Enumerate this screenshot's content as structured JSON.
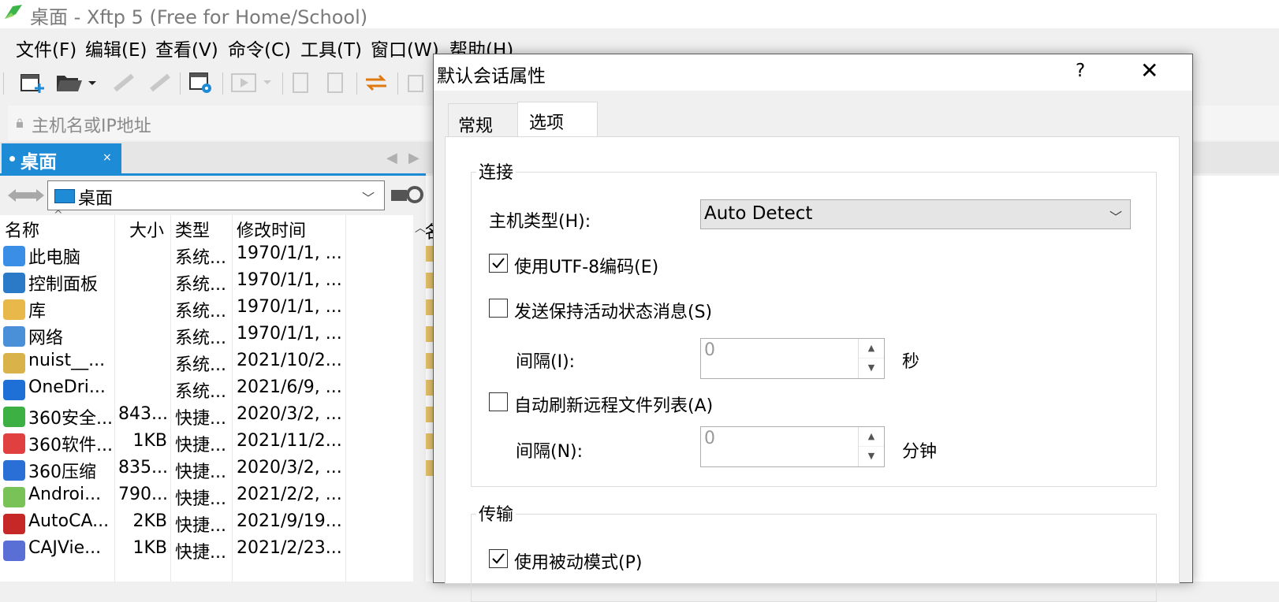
{
  "window": {
    "title": "桌面 - Xftp 5 (Free for Home/School)"
  },
  "menu": [
    "文件(F)",
    "编辑(E)",
    "查看(V)",
    "命令(C)",
    "工具(T)",
    "窗口(W)",
    "帮助(H)"
  ],
  "address": {
    "placeholder": "主机名或IP地址"
  },
  "tab": {
    "label": "桌面",
    "close": "×"
  },
  "path": {
    "text": "桌面"
  },
  "columns": {
    "name": "名称",
    "size": "大小",
    "type": "类型",
    "modified": "修改时间"
  },
  "files": [
    {
      "name": "此电脑",
      "size": "",
      "type": "系统...",
      "modified": "1970/1/1, ...",
      "icon": "computer-icon"
    },
    {
      "name": "控制面板",
      "size": "",
      "type": "系统...",
      "modified": "1970/1/1, ...",
      "icon": "control-panel-icon"
    },
    {
      "name": "库",
      "size": "",
      "type": "系统...",
      "modified": "1970/1/1, ...",
      "icon": "library-icon"
    },
    {
      "name": "网络",
      "size": "",
      "type": "系统...",
      "modified": "1970/1/1, ...",
      "icon": "network-icon"
    },
    {
      "name": "nuist__...",
      "size": "",
      "type": "系统...",
      "modified": "2021/10/2...",
      "icon": "user-folder-icon"
    },
    {
      "name": "OneDri...",
      "size": "",
      "type": "系统...",
      "modified": "2021/6/9, ...",
      "icon": "onedrive-icon"
    },
    {
      "name": "360安全...",
      "size": "843...",
      "type": "快捷...",
      "modified": "2020/3/2, ...",
      "icon": "360-security-icon"
    },
    {
      "name": "360软件...",
      "size": "1KB",
      "type": "快捷...",
      "modified": "2021/11/2...",
      "icon": "360-software-icon"
    },
    {
      "name": "360压缩",
      "size": "835...",
      "type": "快捷...",
      "modified": "2020/3/2, ...",
      "icon": "360-zip-icon"
    },
    {
      "name": "Androi...",
      "size": "790...",
      "type": "快捷...",
      "modified": "2021/2/2, ...",
      "icon": "android-icon"
    },
    {
      "name": "AutoCA...",
      "size": "2KB",
      "type": "快捷...",
      "modified": "2021/9/19...",
      "icon": "autocad-icon"
    },
    {
      "name": "CAJVie...",
      "size": "1KB",
      "type": "快捷...",
      "modified": "2021/2/23...",
      "icon": "cajviewer-icon"
    }
  ],
  "right_pane": {
    "header_fragment": "名"
  },
  "dialog": {
    "title": "默认会话属性",
    "help": "?",
    "close": "✕",
    "tabs": [
      "常规",
      "选项"
    ],
    "active_tab": "选项",
    "connection": {
      "group_title": "连接",
      "host_type_label": "主机类型(H):",
      "host_type_value": "Auto Detect",
      "utf8_label": "使用UTF-8编码(E)",
      "utf8_checked": true,
      "keepalive_label": "发送保持活动状态消息(S)",
      "keepalive_checked": false,
      "keepalive_interval_label": "间隔(I):",
      "keepalive_interval_value": "0",
      "keepalive_unit": "秒",
      "refresh_label": "自动刷新远程文件列表(A)",
      "refresh_checked": false,
      "refresh_interval_label": "间隔(N):",
      "refresh_interval_value": "0",
      "refresh_unit": "分钟"
    },
    "transfer": {
      "group_title": "传输",
      "passive_label": "使用被动模式(P)",
      "passive_checked": true
    }
  },
  "colors": {
    "accent": "#1e8bd6",
    "folder": "#e8c46a"
  }
}
